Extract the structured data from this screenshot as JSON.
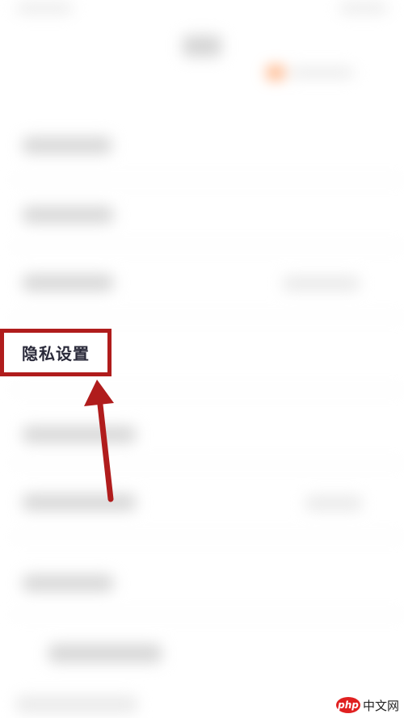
{
  "highlight": {
    "label": "隐私设置",
    "color": "#b01c1c"
  },
  "arrow": {
    "color": "#b01c1c",
    "icon": "arrow-up-icon"
  },
  "watermark": {
    "badge": "php",
    "text": "中文网",
    "color": "#e02020"
  },
  "background": {
    "note_colors": {
      "accent": "#ff9a5c",
      "blur": "#d5d5d5"
    }
  }
}
